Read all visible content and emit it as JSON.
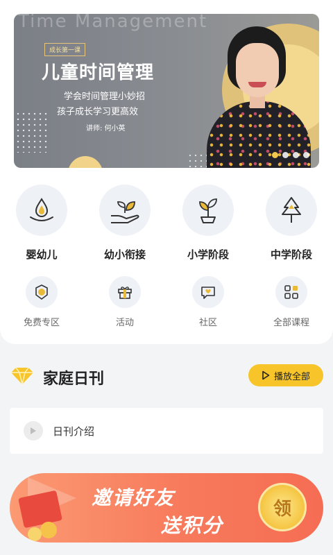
{
  "banner": {
    "watermark": "Time Management",
    "tag": "成长第一课",
    "title": "儿童时间管理",
    "subtitle_1": "学会时间管理小妙招",
    "subtitle_2": "孩子成长学习更高效",
    "lecturer": "讲师: 何小英",
    "page_count": 4,
    "active_page": 1
  },
  "categories": [
    {
      "label": "婴幼儿",
      "icon": "water-drop-icon"
    },
    {
      "label": "幼小衔接",
      "icon": "hand-sprout-icon"
    },
    {
      "label": "小学阶段",
      "icon": "plant-pot-icon"
    },
    {
      "label": "中学阶段",
      "icon": "tree-icon"
    }
  ],
  "shortcuts": [
    {
      "label": "免费专区",
      "icon": "free-badge-icon"
    },
    {
      "label": "活动",
      "icon": "gift-icon"
    },
    {
      "label": "社区",
      "icon": "heart-chat-icon"
    },
    {
      "label": "全部课程",
      "icon": "grid-icon"
    }
  ],
  "daily": {
    "title": "家庭日刊",
    "play_all": "播放全部",
    "intro": "日刊介绍"
  },
  "invite": {
    "line_1": "邀请好友",
    "line_2": "送积分",
    "badge": "领"
  },
  "colors": {
    "accent": "#f7c52a",
    "icon_gold": "#e9b93a",
    "invite_start": "#fb9a73",
    "invite_end": "#f56d54"
  }
}
